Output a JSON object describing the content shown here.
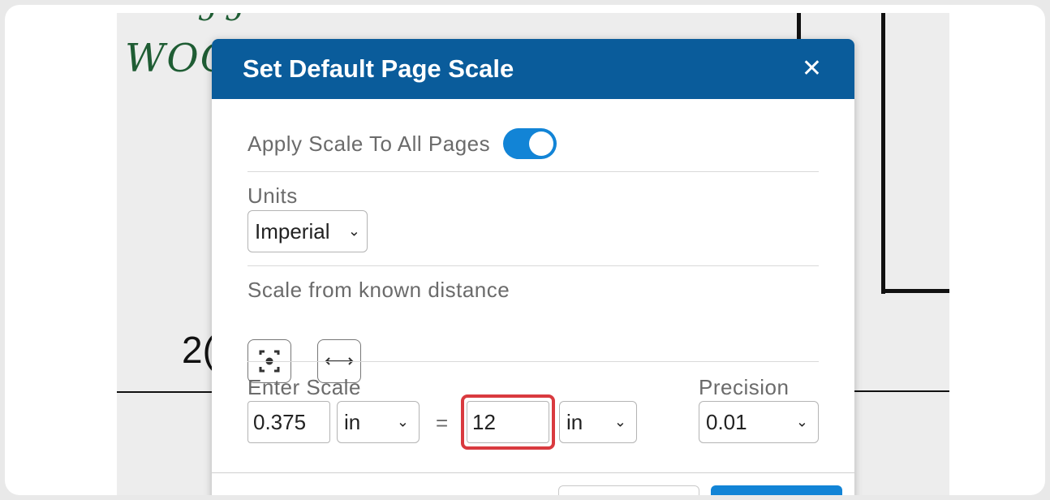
{
  "background": {
    "sketch_word": "WOC",
    "sketch_number": "2("
  },
  "dialog": {
    "title": "Set Default Page Scale",
    "close_glyph": "✕",
    "apply_all": {
      "label": "Apply Scale To All Pages",
      "enabled": true
    },
    "units": {
      "label": "Units",
      "value": "Imperial"
    },
    "known_distance": {
      "label": "Scale from known distance",
      "icons": [
        "focus-target-icon",
        "horizontal-measure-icon"
      ]
    },
    "scale": {
      "label": "Enter Scale",
      "left_value": "0.375",
      "left_unit": "in",
      "equals": "=",
      "right_value": "12",
      "right_unit": "in"
    },
    "precision": {
      "label": "Precision",
      "value": "0.01"
    }
  },
  "colors": {
    "header": "#0a5c9b",
    "toggle_on": "#1284d6",
    "highlight": "#d93a3f"
  }
}
